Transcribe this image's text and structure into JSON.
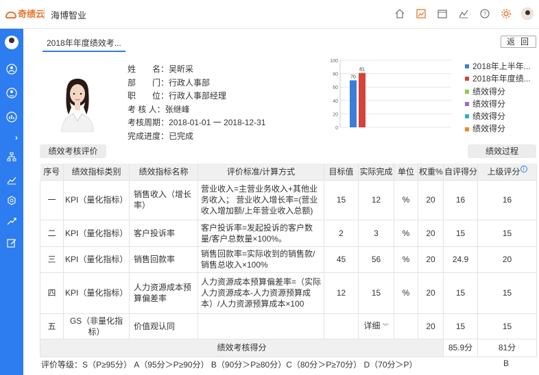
{
  "topbar": {
    "logo_text": "奇绩云",
    "company": "海博智业",
    "icons": [
      "home-icon",
      "image-icon",
      "calendar-icon",
      "chart-icon",
      "help-icon",
      "gear-icon"
    ]
  },
  "sidebar": {
    "icons": [
      "user-circle-icon",
      "people-icon",
      "bar-chart-icon",
      "expand-icon",
      "org-tree-icon",
      "trend-icon",
      "badge-icon",
      "growth-icon",
      "edit-icon"
    ]
  },
  "tab": {
    "label": "2018年年度绩效考..."
  },
  "back_label": "返回",
  "profile": {
    "name_label": "姓　　名：",
    "name": "吴昕采",
    "dept_label": "部　　门：",
    "dept": "行政人事部",
    "position_label": "职　　位：",
    "position": "行政人事部经理",
    "reviewer_label": "考 核 人：",
    "reviewer": "张继峰",
    "period_label": "考核周期：",
    "period": "2018-01-01 一 2018-12-31",
    "progress_label": "完成进度：",
    "progress": "已完成"
  },
  "chart_data": {
    "type": "bar",
    "title": "",
    "xlabel": "",
    "ylabel": "",
    "ylim": [
      0,
      100
    ],
    "yticks": [
      "100",
      "80",
      "60",
      "40",
      "20",
      "0"
    ],
    "series": [
      {
        "name": "2018年上半年...",
        "values": [
          70
        ],
        "color": "#3b7dd8"
      },
      {
        "name": "2018年年度绩...",
        "values": [
          81
        ],
        "color": "#d7423b"
      }
    ],
    "data_labels": [
      "70",
      "81"
    ],
    "legend": [
      {
        "label": "2018年上半年...",
        "color": "#3b7dd8"
      },
      {
        "label": "2018年年度绩...",
        "color": "#d7423b"
      },
      {
        "label": "绩效得分",
        "color": "#8ccc4b"
      },
      {
        "label": "绩效得分",
        "color": "#9b6ad2"
      },
      {
        "label": "绩效得分",
        "color": "#2ab2c8"
      },
      {
        "label": "绩效得分",
        "color": "#f08a2a"
      }
    ],
    "legend_position": "right"
  },
  "buttons": {
    "eval_label": "绩效考核评价",
    "process_label": "绩效过程"
  },
  "table": {
    "headers": [
      "序号",
      "绩效指标类别",
      "绩效指标名称",
      "评价标准/计算方式",
      "目标值",
      "实际完成",
      "单位",
      "权重%",
      "自评得分",
      "上级评分"
    ],
    "rows": [
      {
        "no": "一",
        "cat": "KPI（量化指标）",
        "name": "销售收入（增长率）",
        "crit": "营业收入=主营业务收入+其他业务收入； 营业收入增长率=(营业收入增加额/上年营业收入总额)",
        "target": "15",
        "actual": "12",
        "unit": "%",
        "weight": "20",
        "self": "16",
        "sup": "16"
      },
      {
        "no": "二",
        "cat": "KPI（量化指标）",
        "name": "客户投诉率",
        "crit": "客户投诉率=发起投诉的客户数量/客户总数量×100%。",
        "target": "2",
        "actual": "3",
        "unit": "%",
        "weight": "20",
        "self": "15",
        "sup": "15"
      },
      {
        "no": "三",
        "cat": "KPI（量化指标）",
        "name": "销售回款率",
        "crit": "销售回款率=实际收到的销售款/销售总收入×100%",
        "target": "45",
        "actual": "56",
        "unit": "%",
        "weight": "20",
        "self": "24.9",
        "sup": "20"
      },
      {
        "no": "四",
        "cat": "KPI（量化指标）",
        "name": "人力资源成本预算偏差率",
        "crit": "人力资源成本预算偏差率=（实际人力资源成本-人力资源预算成本）/人力资源预算成本×100",
        "target": "12",
        "actual": "15",
        "unit": "%",
        "weight": "20",
        "self": "15",
        "sup": "15"
      },
      {
        "no": "五",
        "cat": "GS（非量化指标）",
        "name": "价值观认同",
        "crit": "",
        "target": "",
        "actual": "详细",
        "unit": "",
        "weight": "20",
        "self": "15",
        "sup": "15"
      }
    ],
    "summary_label": "绩效考核得分",
    "summary_self": "85.9分",
    "summary_sup": "81分"
  },
  "grade": {
    "text": "评价等级：S（P≥95分）  A（95分＞P≥90分）  B（90分＞P≥80分）C（80分＞P≥70分）  D（70分＞P）",
    "value": "B"
  }
}
